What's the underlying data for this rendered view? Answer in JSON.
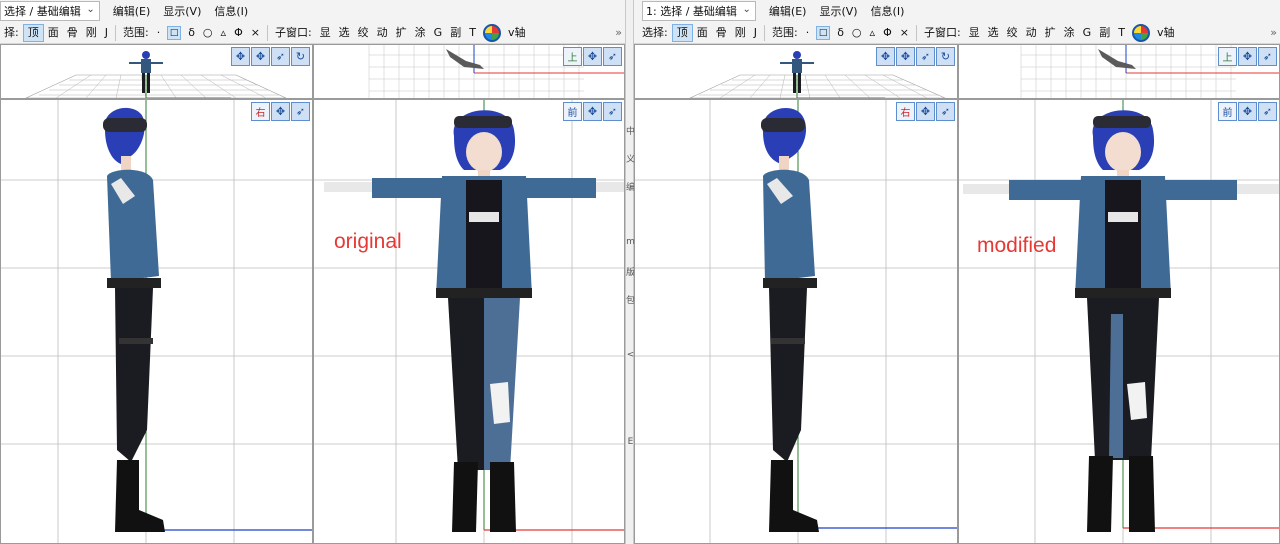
{
  "panes": [
    {
      "id": "left",
      "mode_select": "选择 / 基础编辑",
      "menus": [
        "编辑(E)",
        "显示(V)",
        "信息(I)"
      ],
      "toolbar": {
        "select_label": "择:",
        "view_buttons": [
          "顶",
          "面",
          "骨",
          "刚",
          "J"
        ],
        "range_label": "范围:",
        "range_buttons": [
          "·",
          "δ",
          "○",
          "▵",
          "Φ",
          "×"
        ],
        "subwindow_label": "子窗口:",
        "subwindow_buttons": [
          "显",
          "选",
          "绞",
          "动",
          "扩",
          "涂",
          "G",
          "副",
          "T"
        ],
        "axis_label": "v轴"
      },
      "overlay_text": "original",
      "views": {
        "top_right": "上",
        "side": "右",
        "front": "前"
      }
    },
    {
      "id": "right",
      "mode_select": "1: 选择 / 基础编辑",
      "menus": [
        "编辑(E)",
        "显示(V)",
        "信息(I)"
      ],
      "toolbar": {
        "select_label": "选择:",
        "view_buttons": [
          "顶",
          "面",
          "骨",
          "刚",
          "J"
        ],
        "range_label": "范围:",
        "range_buttons": [
          "·",
          "δ",
          "○",
          "▵",
          "Φ",
          "×"
        ],
        "subwindow_label": "子窗口:",
        "subwindow_buttons": [
          "显",
          "选",
          "绞",
          "动",
          "扩",
          "涂",
          "G",
          "副",
          "T"
        ],
        "axis_label": "v轴"
      },
      "overlay_text": "modified",
      "views": {
        "top_right": "上",
        "side": "右",
        "front": "前"
      }
    }
  ],
  "divider_chars": [
    "中",
    "义",
    "编",
    "m",
    "版",
    "包",
    "<",
    "E"
  ],
  "icons": {
    "move": "move-arrows-icon",
    "bone": "bone-arrow-icon",
    "rotate": "rotate-icon",
    "axis": "axis-globe-icon"
  },
  "colors": {
    "accent": "#1a4e9c",
    "overlay_text": "#e53935",
    "x_axis": "#e53935",
    "y_axis": "#2e7d32",
    "z_axis": "#1e40c8",
    "hair": "#2a3fb5",
    "jacket": "#34577d",
    "pants": "#1b1b22",
    "jeans": "#4d6f96"
  }
}
